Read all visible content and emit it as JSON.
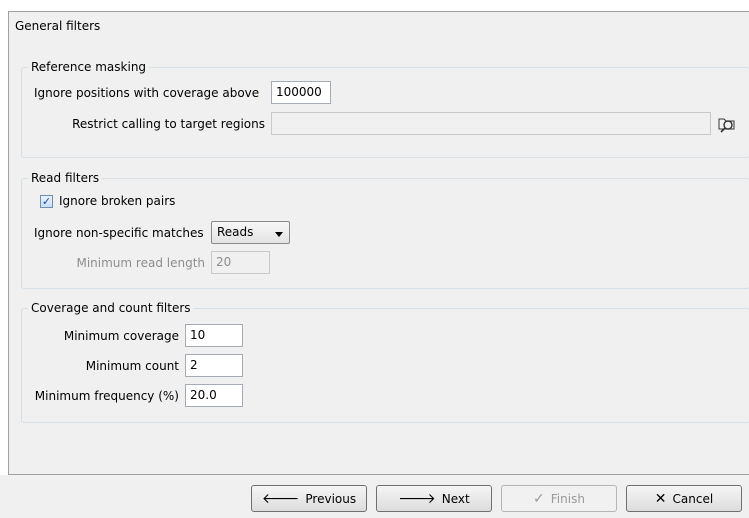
{
  "panel": {
    "title": "General filters"
  },
  "reference_masking": {
    "title": "Reference masking",
    "coverage_label": "Ignore positions with coverage above",
    "coverage_value": "100000",
    "target_label": "Restrict calling to target regions",
    "target_value": ""
  },
  "read_filters": {
    "title": "Read filters",
    "broken_pairs_label": "Ignore broken pairs",
    "broken_pairs_checked": true,
    "nonspecific_label": "Ignore non-specific matches",
    "nonspecific_value": "Reads",
    "min_read_length_label": "Minimum read length",
    "min_read_length_value": "20"
  },
  "coverage_filters": {
    "title": "Coverage and count filters",
    "min_coverage_label": "Minimum coverage",
    "min_coverage_value": "10",
    "min_count_label": "Minimum count",
    "min_count_value": "2",
    "min_frequency_label": "Minimum frequency (%)",
    "min_frequency_value": "20.0"
  },
  "buttons": {
    "previous": "Previous",
    "next": "Next",
    "finish": "Finish",
    "cancel": "Cancel"
  },
  "icons": {
    "browse": "browse-folder-icon",
    "previous": "arrow-left-icon",
    "next": "arrow-right-icon",
    "finish": "checkmark-icon",
    "cancel": "x-icon"
  }
}
